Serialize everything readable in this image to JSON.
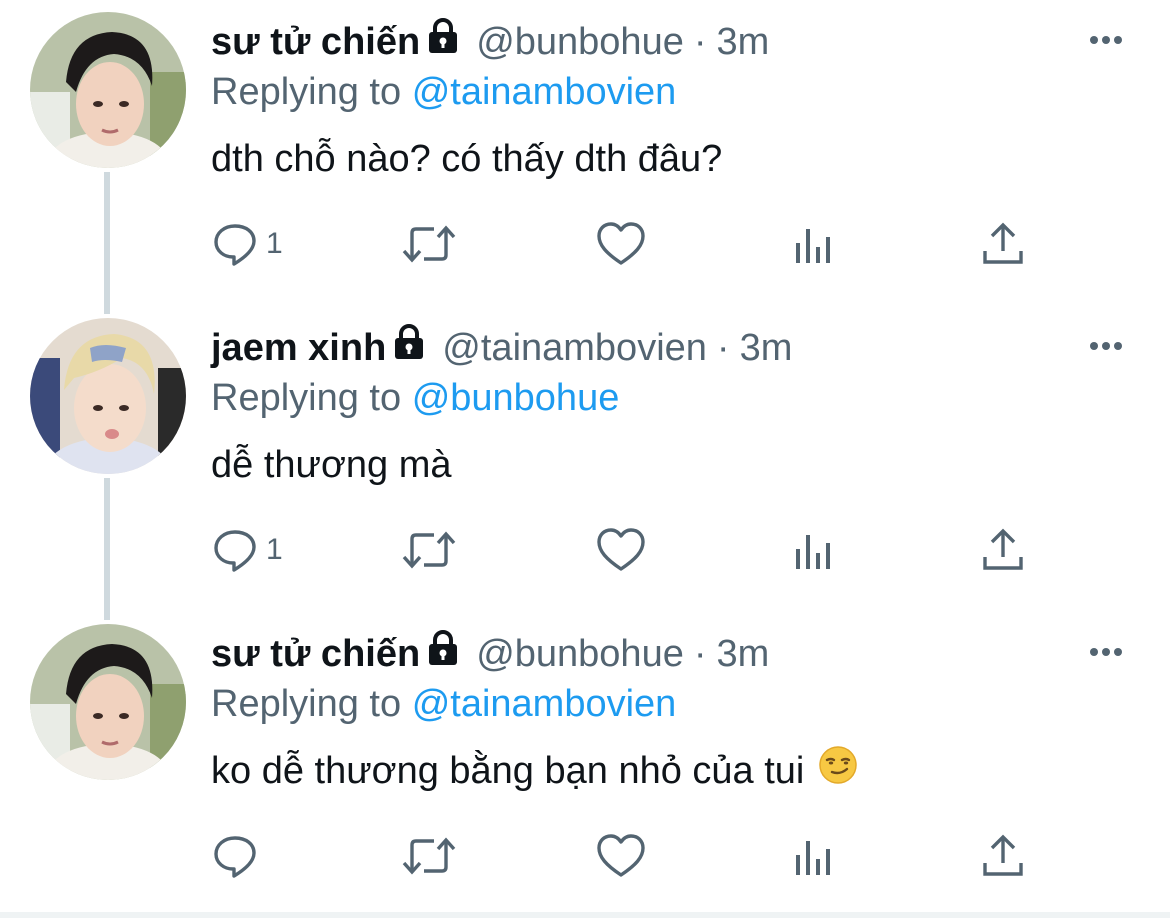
{
  "tweets": [
    {
      "display_name": "sư tử chiến",
      "locked_icon": "lock-icon",
      "handle": "@bunbohue",
      "separator": "·",
      "time": "3m",
      "replying_prefix": "Replying to",
      "replying_handle": "@tainambovien",
      "text": "dth chỗ nào? có thấy dth đâu?",
      "reply_count": "1"
    },
    {
      "display_name": "jaem xinh",
      "locked_icon": "lock-icon",
      "handle": "@tainambovien",
      "separator": "·",
      "time": "3m",
      "replying_prefix": "Replying to",
      "replying_handle": "@bunbohue",
      "text": "dễ thương mà",
      "reply_count": "1"
    },
    {
      "display_name": "sư tử chiến",
      "locked_icon": "lock-icon",
      "handle": "@bunbohue",
      "separator": "·",
      "time": "3m",
      "replying_prefix": "Replying to",
      "replying_handle": "@tainambovien",
      "text": "ko dễ thương bằng bạn nhỏ của tui",
      "emoji": "smirking-face-emoji",
      "reply_count": ""
    }
  ],
  "colors": {
    "text": "#0f1419",
    "secondary": "#536471",
    "link": "#1d9bf0",
    "thread_line": "#cfd9de"
  }
}
